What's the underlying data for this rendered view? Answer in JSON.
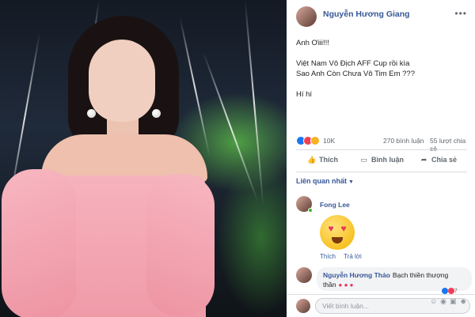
{
  "post": {
    "author": "Nguyễn Hương Giang",
    "more": "•••",
    "lines": [
      "Anh Ơiii!!!",
      "",
      "Việt Nam Vô Địch AFF Cup rồi kìa",
      "Sao Anh Còn Chưa Vô Tim Em ???",
      "",
      "Hí hí"
    ]
  },
  "stats": {
    "reactions": "10K",
    "comments": "270 bình luận",
    "shares": "55 lượt chia sẻ"
  },
  "actions": {
    "like": "Thích",
    "comment": "Bình luận",
    "share": "Chia sẻ",
    "like_icon": "thumbs-up-icon",
    "comment_icon": "comment-icon",
    "share_icon": "share-icon"
  },
  "sort_label": "Liên quan nhất",
  "comments": [
    {
      "name": "Fong Lee",
      "sticker": "heart-eyes-emoji",
      "links": [
        "Thích",
        "Trả lời"
      ]
    },
    {
      "name": "Nguyễn Hương Thảo",
      "text": "Bạch thiền thượng thần",
      "reaction_count": "7"
    }
  ],
  "composer": {
    "placeholder": "Viết bình luận..."
  },
  "colors": {
    "link": "#385898",
    "like": "#1877f2",
    "love": "#f33e58",
    "dress": "#f6b3bd"
  }
}
